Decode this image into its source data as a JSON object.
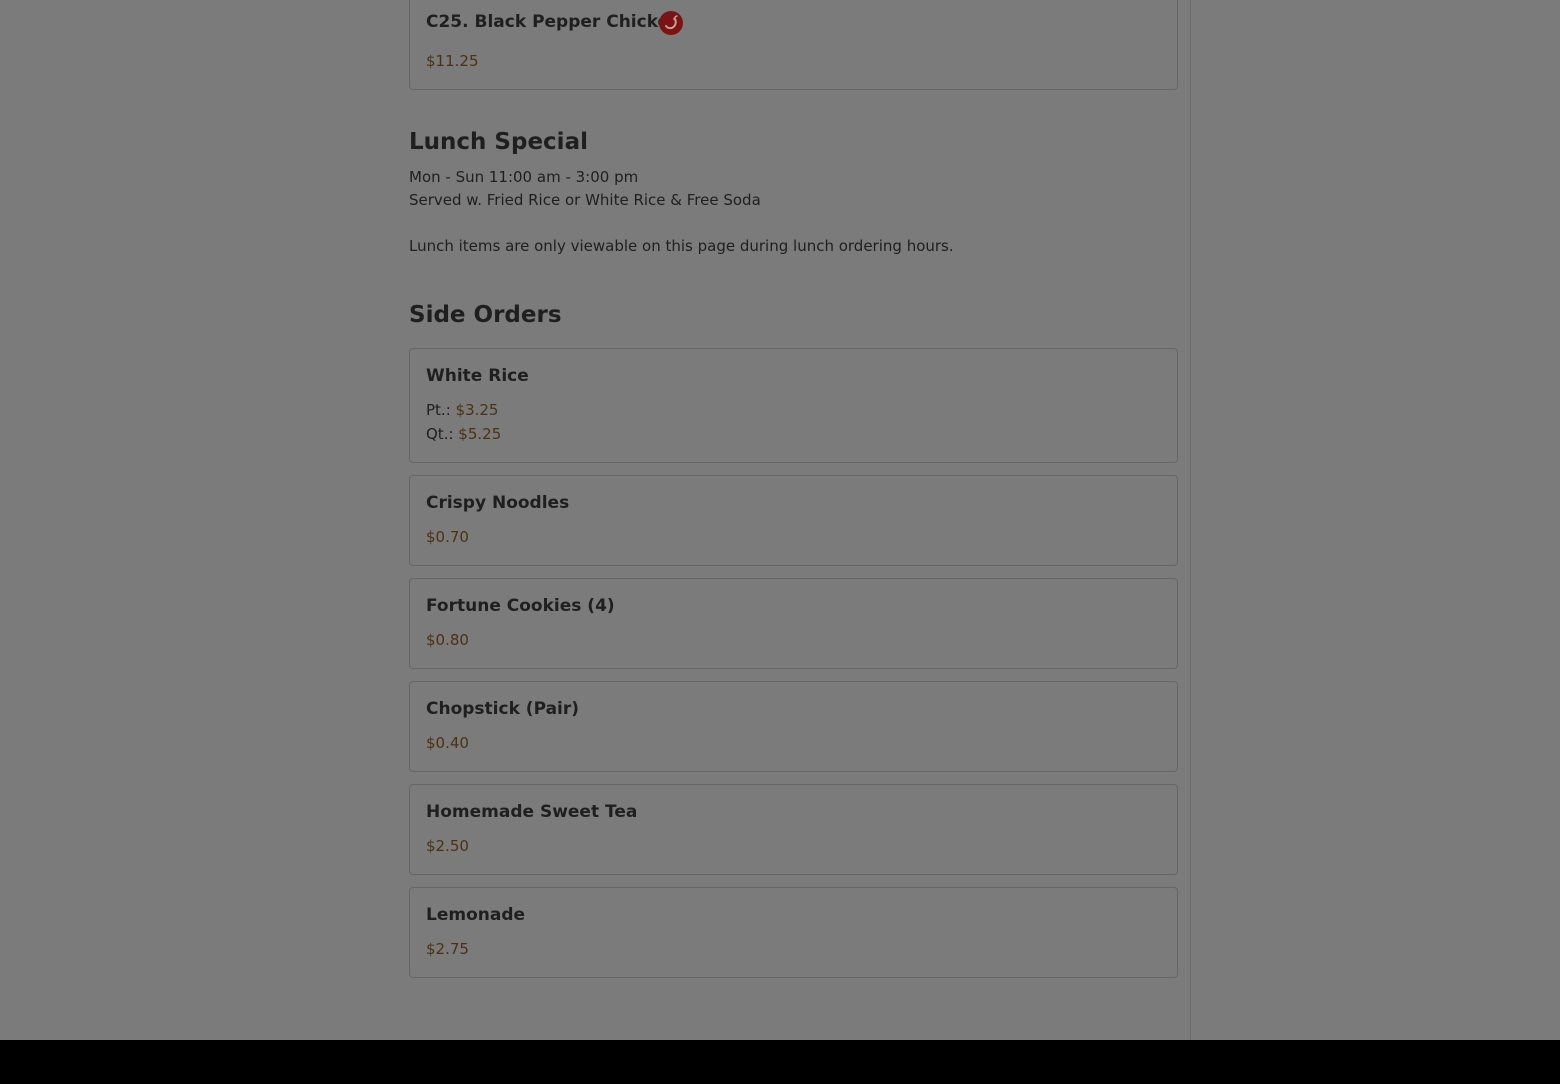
{
  "top_item": {
    "name": "C25. Black Pepper Chicken",
    "price": "$11.25",
    "icon": "chili-pepper-icon"
  },
  "lunch_section": {
    "title": "Lunch Special",
    "hours": "Mon - Sun 11:00 am - 3:00 pm",
    "served": "Served w. Fried Rice or White Rice & Free Soda",
    "note": "Lunch items are only viewable on this page during lunch ordering hours."
  },
  "side_orders": {
    "title": "Side Orders",
    "white_rice": {
      "name": "White Rice",
      "pt_label": "Pt.:",
      "pt_price": "$3.25",
      "qt_label": "Qt.:",
      "qt_price": "$5.25"
    },
    "items": [
      {
        "name": "Crispy Noodles",
        "price": "$0.70"
      },
      {
        "name": "Fortune Cookies (4)",
        "price": "$0.80"
      },
      {
        "name": "Chopstick (Pair)",
        "price": "$0.40"
      },
      {
        "name": "Homemade Sweet Tea",
        "price": "$2.50"
      },
      {
        "name": "Lemonade",
        "price": "$2.75"
      }
    ]
  },
  "colors": {
    "overlay_background": "#7b7b7b",
    "price_color": "#4a3211",
    "spicy_icon_bg": "#7a1414",
    "footer": "#000000"
  }
}
